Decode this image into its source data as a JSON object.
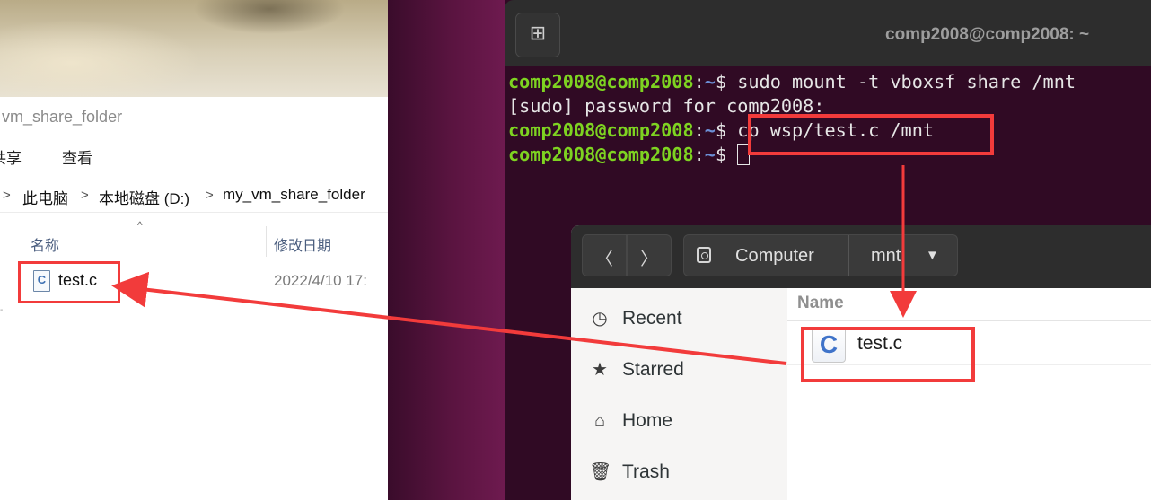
{
  "explorer": {
    "title_fragment": "vm_share_folder",
    "ribbon": [
      "共享",
      "查看"
    ],
    "ribbon_visible": [
      "共享",
      "查看"
    ],
    "breadcrumb": [
      "此电脑",
      "本地磁盘 (D:)",
      "my_vm_share_folder"
    ],
    "breadcrumb_sep": ">",
    "columns": {
      "name": "名称",
      "modified": "修改日期"
    },
    "file": {
      "name": "test.c",
      "modified": "2022/4/10 17:",
      "icon_letter": "C"
    }
  },
  "terminal": {
    "title": "comp2008@comp2008: ~",
    "new_tab_glyph": "⊞",
    "prompt_user": "comp2008@comp2008",
    "prompt_sep": ":",
    "prompt_path": "~",
    "prompt_sym": "$",
    "lines": [
      {
        "type": "cmd",
        "text": "sudo mount -t vboxsf share /mnt"
      },
      {
        "type": "out",
        "text": "[sudo] password for comp2008:"
      },
      {
        "type": "cmd",
        "text": "cp wsp/test.c /mnt"
      },
      {
        "type": "cmd",
        "text": ""
      }
    ]
  },
  "files": {
    "back_glyph": "〈",
    "forward_glyph": "〉",
    "path": {
      "root": "Computer",
      "current": "mnt"
    },
    "sidebar": [
      {
        "label": "Recent",
        "icon": "clock-icon"
      },
      {
        "label": "Starred",
        "icon": "star-icon"
      },
      {
        "label": "Home",
        "icon": "home-icon"
      },
      {
        "label": "Trash",
        "icon": "trash-icon"
      }
    ],
    "list_header": "Name",
    "file": {
      "name": "test.c",
      "icon_letter": "C"
    }
  },
  "annotations": {
    "highlight_color": "#f23b3b"
  }
}
